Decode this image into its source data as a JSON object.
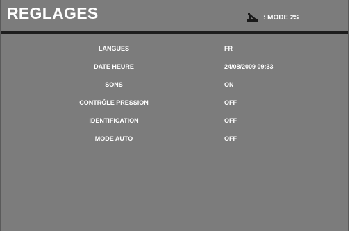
{
  "header": {
    "title": "REGLAGES",
    "mode_icon": "stair-step-icon",
    "mode_label": ": MODE 2S"
  },
  "settings": [
    {
      "label": "LANGUES",
      "value": "FR"
    },
    {
      "label": "DATE  HEURE",
      "value": "24/08/2009 09:33"
    },
    {
      "label": "SONS",
      "value": "ON"
    },
    {
      "label": "CONTRÔLE PRESSION",
      "value": "OFF"
    },
    {
      "label": "IDENTIFICATION",
      "value": "OFF"
    },
    {
      "label": "MODE AUTO",
      "value": "OFF"
    }
  ],
  "colors": {
    "background": "#7c7c7c",
    "divider": "#1d1d1d",
    "text": "#ffffff"
  }
}
